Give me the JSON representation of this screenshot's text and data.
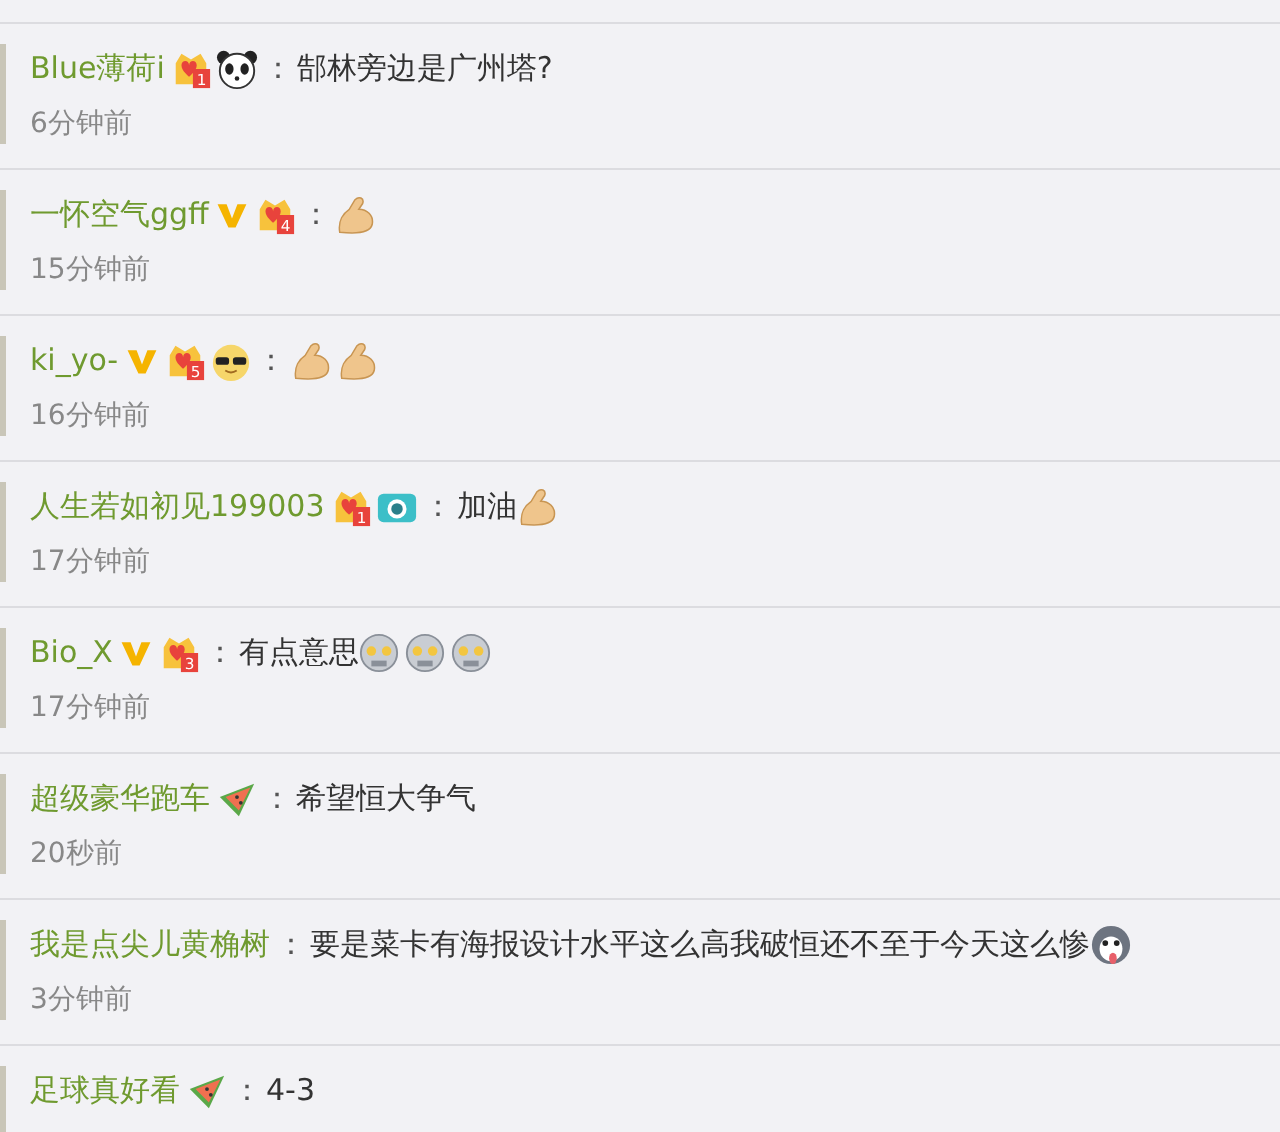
{
  "comments": [
    {
      "user": "Blue薄荷i",
      "badges": [
        {
          "kind": "fan",
          "label": "1"
        },
        {
          "kind": "panda"
        }
      ],
      "colon": "：",
      "content": [
        {
          "kind": "text",
          "text": "郜林旁边是广州塔?"
        }
      ],
      "time": "6分钟前"
    },
    {
      "user": "一怀空气ggff",
      "badges": [
        {
          "kind": "vip"
        },
        {
          "kind": "fan",
          "label": "4"
        }
      ],
      "colon": "：",
      "content": [
        {
          "kind": "muscle"
        }
      ],
      "time": "15分钟前"
    },
    {
      "user": "ki_yo-",
      "badges": [
        {
          "kind": "vip"
        },
        {
          "kind": "fan",
          "label": "5"
        },
        {
          "kind": "cool"
        }
      ],
      "colon": "：",
      "content": [
        {
          "kind": "muscle"
        },
        {
          "kind": "muscle"
        }
      ],
      "time": "16分钟前"
    },
    {
      "user": "人生若如初见199003",
      "badges": [
        {
          "kind": "fan",
          "label": "1"
        },
        {
          "kind": "camera"
        }
      ],
      "colon": "：",
      "content": [
        {
          "kind": "text",
          "text": "加油"
        },
        {
          "kind": "muscle"
        }
      ],
      "time": "17分钟前"
    },
    {
      "user": "Bio_X",
      "badges": [
        {
          "kind": "vip"
        },
        {
          "kind": "fan",
          "label": "3"
        }
      ],
      "colon": "：",
      "content": [
        {
          "kind": "text",
          "text": "有点意思"
        },
        {
          "kind": "robot"
        },
        {
          "kind": "robot"
        },
        {
          "kind": "robot"
        }
      ],
      "time": "17分钟前"
    },
    {
      "user": "超级豪华跑车",
      "badges": [
        {
          "kind": "melon"
        }
      ],
      "colon": "：",
      "content": [
        {
          "kind": "text",
          "text": "希望恒大争气"
        }
      ],
      "time": "20秒前"
    },
    {
      "user": "我是点尖儿黄桷树",
      "colon": "：",
      "content": [
        {
          "kind": "text",
          "text": "要是菜卡有海报设计水平这么高我破恒还不至于今天这么惨"
        },
        {
          "kind": "husky"
        }
      ],
      "time": "3分钟前"
    },
    {
      "user": "足球真好看",
      "badges": [
        {
          "kind": "melon"
        }
      ],
      "colon": "：",
      "content": [
        {
          "kind": "text",
          "text": "4-3"
        }
      ]
    }
  ]
}
